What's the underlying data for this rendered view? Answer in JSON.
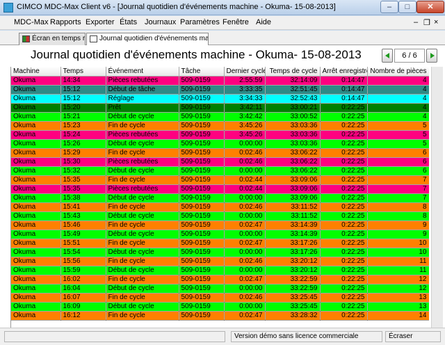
{
  "window": {
    "title": "CIMCO MDC-Max Client v6 - [Journal quotidien d'événements machine  - Okuma- 15-08-2013]"
  },
  "menu": {
    "items": [
      "MDC-Max",
      "Rapports",
      "Exporter",
      "États",
      "Journaux",
      "Paramètres",
      "Fenêtre",
      "Aide"
    ]
  },
  "tabs": [
    {
      "label": "Écran en temps rée"
    },
    {
      "label": "Journal quotidien d'événements machin..."
    }
  ],
  "report": {
    "title": "Journal quotidien d'événements machine  - Okuma- 15-08-2013",
    "page": "6 / 6"
  },
  "table": {
    "headers": [
      "Machine",
      "Temps",
      "Événement",
      "Tâche",
      "Dernier cycle",
      "Temps de cycle",
      "Arrêt enregistré",
      "Nombre de pièces"
    ],
    "rows": [
      [
        "Okuma",
        "14:34",
        "Pièces rebutées",
        "509-0159",
        "2:55:59",
        "32:14:09",
        "0:14:47",
        "4"
      ],
      [
        "Okuma",
        "15:12",
        "Début de tâche",
        "509-0159",
        "3:33:35",
        "32:51:45",
        "0:14:47",
        "4"
      ],
      [
        "Okuma",
        "15:12",
        "Réglage",
        "509-0159",
        "3:34:33",
        "32:52:43",
        "0:14:47",
        "4"
      ],
      [
        "Okuma",
        "15:20",
        "Prêt",
        "509-0159",
        "3:42:11",
        "33:00:21",
        "0:22:25",
        "4"
      ],
      [
        "Okuma",
        "15:21",
        "Début de cycle",
        "509-0159",
        "3:42:42",
        "33:00:52",
        "0:22:25",
        "4"
      ],
      [
        "Okuma",
        "15:23",
        "Fin de cycle",
        "509-0159",
        "3:45:26",
        "33:03:36",
        "0:22:25",
        "5"
      ],
      [
        "Okuma",
        "15:24",
        "Pièces rebutées",
        "509-0159",
        "3:45:26",
        "33:03:36",
        "0:22:25",
        "5"
      ],
      [
        "Okuma",
        "15:26",
        "Début de cycle",
        "509-0159",
        "0:00:00",
        "33:03:36",
        "0:22:25",
        "5"
      ],
      [
        "Okuma",
        "15:29",
        "Fin de cycle",
        "509-0159",
        "0:02:46",
        "33:06:22",
        "0:22:25",
        "6"
      ],
      [
        "Okuma",
        "15:30",
        "Pièces rebutées",
        "509-0159",
        "0:02:46",
        "33:06:22",
        "0:22:25",
        "6"
      ],
      [
        "Okuma",
        "15:32",
        "Début de cycle",
        "509-0159",
        "0:00:00",
        "33:06:22",
        "0:22:25",
        "6"
      ],
      [
        "Okuma",
        "15:35",
        "Fin de cycle",
        "509-0159",
        "0:02:44",
        "33:09:06",
        "0:22:25",
        "7"
      ],
      [
        "Okuma",
        "15:35",
        "Pièces rebutées",
        "509-0159",
        "0:02:44",
        "33:09:06",
        "0:22:25",
        "7"
      ],
      [
        "Okuma",
        "15:38",
        "Début de cycle",
        "509-0159",
        "0:00:00",
        "33:09:06",
        "0:22:25",
        "7"
      ],
      [
        "Okuma",
        "15:41",
        "Fin de cycle",
        "509-0159",
        "0:02:46",
        "33:11:52",
        "0:22:25",
        "8"
      ],
      [
        "Okuma",
        "15:43",
        "Début de cycle",
        "509-0159",
        "0:00:00",
        "33:11:52",
        "0:22:25",
        "8"
      ],
      [
        "Okuma",
        "15:46",
        "Fin de cycle",
        "509-0159",
        "0:02:47",
        "33:14:39",
        "0:22:25",
        "9"
      ],
      [
        "Okuma",
        "15:49",
        "Début de cycle",
        "509-0159",
        "0:00:00",
        "33:14:39",
        "0:22:25",
        "9"
      ],
      [
        "Okuma",
        "15:51",
        "Fin de cycle",
        "509-0159",
        "0:02:47",
        "33:17:26",
        "0:22:25",
        "10"
      ],
      [
        "Okuma",
        "15:54",
        "Début de cycle",
        "509-0159",
        "0:00:00",
        "33:17:26",
        "0:22:25",
        "10"
      ],
      [
        "Okuma",
        "15:56",
        "Fin de cycle",
        "509-0159",
        "0:02:46",
        "33:20:12",
        "0:22:25",
        "11"
      ],
      [
        "Okuma",
        "15:59",
        "Début de cycle",
        "509-0159",
        "0:00:00",
        "33:20:12",
        "0:22:25",
        "11"
      ],
      [
        "Okuma",
        "16:02",
        "Fin de cycle",
        "509-0159",
        "0:02:47",
        "33:22:59",
        "0:22:25",
        "12"
      ],
      [
        "Okuma",
        "16:04",
        "Début de cycle",
        "509-0159",
        "0:00:00",
        "33:22:59",
        "0:22:25",
        "12"
      ],
      [
        "Okuma",
        "16:07",
        "Fin de cycle",
        "509-0159",
        "0:02:46",
        "33:25:45",
        "0:22:25",
        "13"
      ],
      [
        "Okuma",
        "16:09",
        "Début de cycle",
        "509-0159",
        "0:00:00",
        "33:25:45",
        "0:22:25",
        "13"
      ],
      [
        "Okuma",
        "16:12",
        "Fin de cycle",
        "509-0159",
        "0:02:47",
        "33:28:32",
        "0:22:25",
        "14"
      ]
    ]
  },
  "event_colors": {
    "Pièces rebutées": "#ff0080",
    "Début de tâche": "#2e8a86",
    "Réglage": "#00ffff",
    "Prêt": "#007f00",
    "Début de cycle": "#00ff00",
    "Fin de cycle": "#ff8000"
  },
  "status": {
    "edition": "Version démo sans licence commerciale",
    "mode": "Écraser"
  }
}
